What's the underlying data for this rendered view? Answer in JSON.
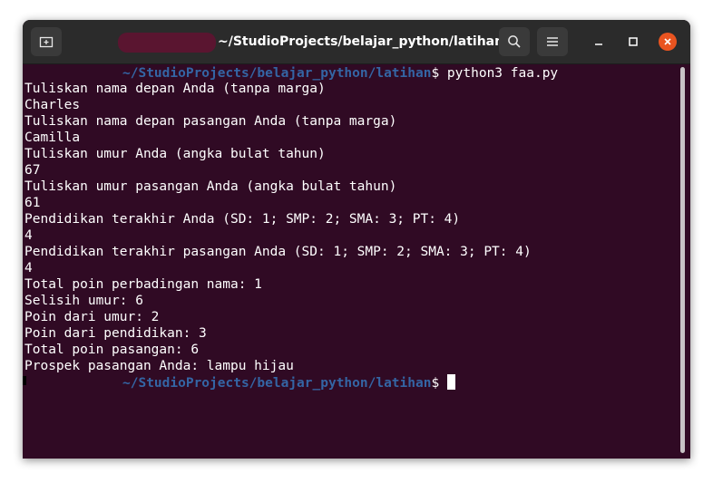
{
  "window": {
    "title": "~/StudioProjects/belajar_python/latihan"
  },
  "terminal": {
    "prompt_path": "~/StudioProjects/belajar_python/latihan",
    "prompt_symbol": "$",
    "command": " python3 faa.py",
    "output_lines": [
      "Tuliskan nama depan Anda (tanpa marga)",
      "Charles",
      "Tuliskan nama depan pasangan Anda (tanpa marga)",
      "Camilla",
      "Tuliskan umur Anda (angka bulat tahun)",
      "67",
      "Tuliskan umur pasangan Anda (angka bulat tahun)",
      "61",
      "Pendidikan terakhir Anda (SD: 1; SMP: 2; SMA: 3; PT: 4)",
      "4",
      "Pendidikan terakhir pasangan Anda (SD: 1; SMP: 2; SMA: 3; PT: 4)",
      "4",
      "Total poin perbadingan nama: 1",
      "Selisih umur: 6",
      "Poin dari umur: 2",
      "Poin dari pendidikan: 3",
      "Total poin pasangan: 6",
      "Prospek pasangan Anda: lampu hijau"
    ]
  },
  "icons": {
    "new_tab": "new-tab-icon",
    "search": "search-icon",
    "menu": "hamburger-menu-icon",
    "minimize": "minimize-icon",
    "maximize": "maximize-icon",
    "close": "close-icon"
  },
  "colors": {
    "terminal_bg": "#300a24",
    "titlebar_bg": "#2b2b2b",
    "prompt_path": "#3465a4",
    "close_button": "#e95420"
  }
}
